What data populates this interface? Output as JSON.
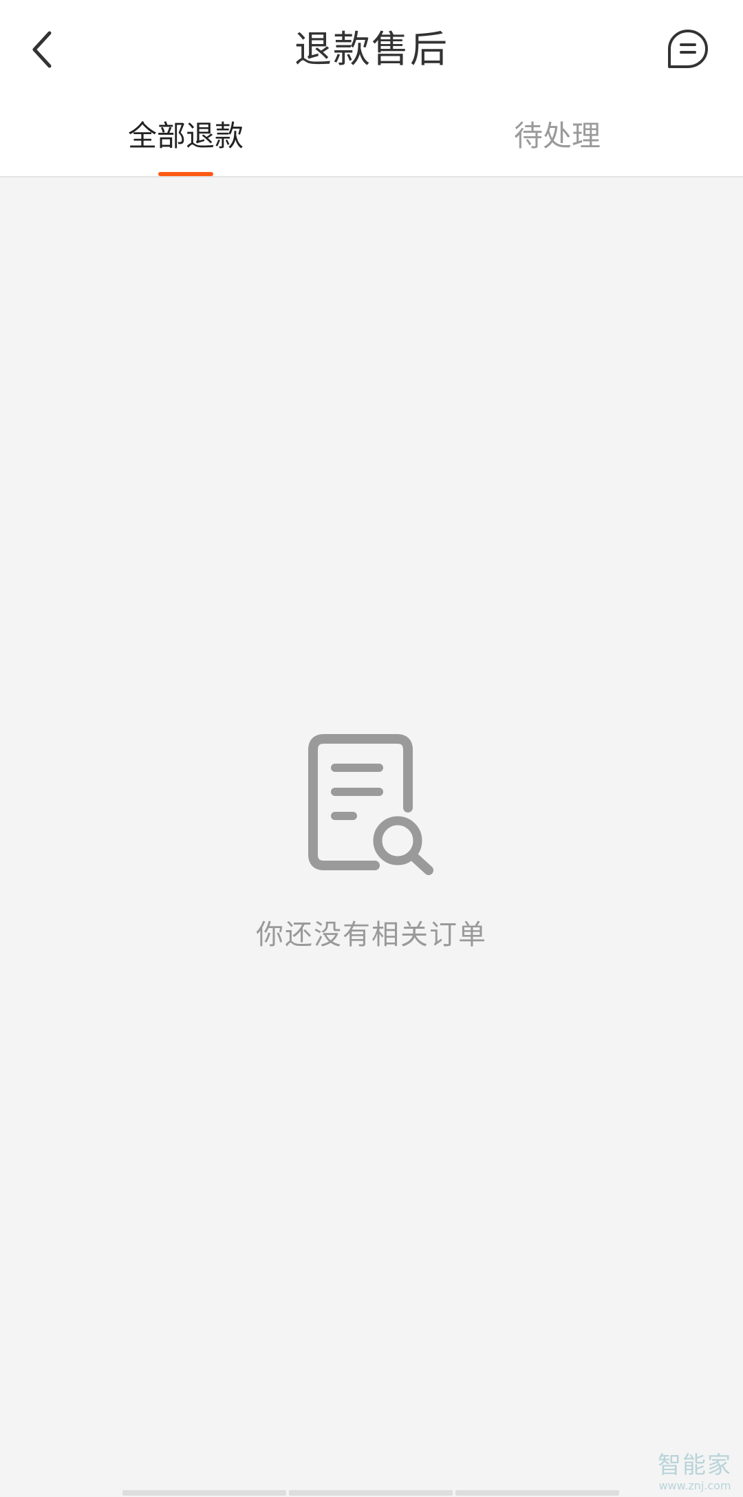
{
  "header": {
    "title": "退款售后",
    "back_icon": "chevron-left-icon",
    "message_icon": "chat-bubble-icon"
  },
  "tabs": [
    {
      "label": "全部退款",
      "active": true
    },
    {
      "label": "待处理",
      "active": false
    }
  ],
  "colors": {
    "accent": "#ff5a14",
    "background": "#f4f4f4",
    "icon_gray": "#9a9a9a"
  },
  "empty_state": {
    "icon": "document-search-icon",
    "text": "你还没有相关订单"
  },
  "watermark": {
    "main": "智能家",
    "sub": "www.znj.com"
  }
}
